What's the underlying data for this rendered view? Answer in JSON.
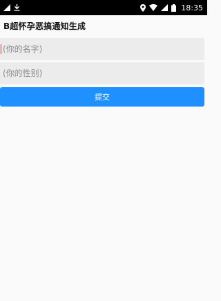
{
  "status_bar": {
    "time": "18:35",
    "icons_left": [
      "signal-icon",
      "download-icon"
    ],
    "icons_right": [
      "location-icon",
      "wifi-icon",
      "signal-icon",
      "battery-icon"
    ]
  },
  "app": {
    "title": "B超怀孕恶搞通知生成"
  },
  "form": {
    "name_placeholder": "(你的名字)",
    "gender_placeholder": "(你的性别)",
    "submit_label": "提交",
    "submit_color": "#1e90ff"
  }
}
